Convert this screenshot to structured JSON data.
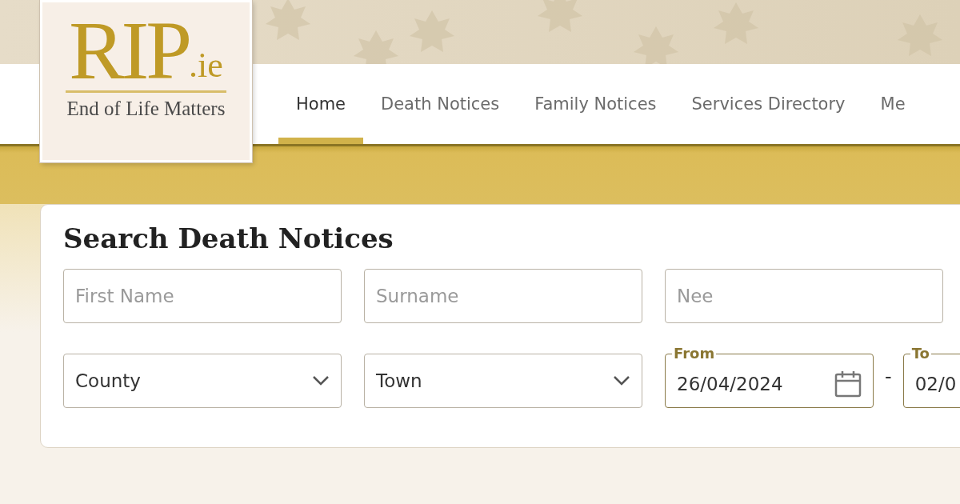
{
  "logo": {
    "wordmark": "RIP",
    "suffix": ".ie",
    "tagline": "End of Life Matters"
  },
  "nav": {
    "items": [
      {
        "label": "Home",
        "selected": true
      },
      {
        "label": "Death Notices",
        "selected": false
      },
      {
        "label": "Family Notices",
        "selected": false
      },
      {
        "label": "Services Directory",
        "selected": false
      },
      {
        "label": "Me",
        "selected": false
      }
    ]
  },
  "search": {
    "title": "Search Death Notices",
    "rows": [
      [
        {
          "kind": "text",
          "placeholder": "First Name"
        },
        {
          "kind": "text",
          "placeholder": "Surname"
        },
        {
          "kind": "text",
          "placeholder": "Nee"
        }
      ],
      [
        {
          "kind": "select",
          "value": "County"
        },
        {
          "kind": "select",
          "value": "Town"
        },
        {
          "kind": "date",
          "label": "From",
          "value": "26/04/2024"
        },
        {
          "kind": "separator",
          "text": "-"
        },
        {
          "kind": "date",
          "label": "To",
          "value": "02/0"
        }
      ]
    ]
  }
}
